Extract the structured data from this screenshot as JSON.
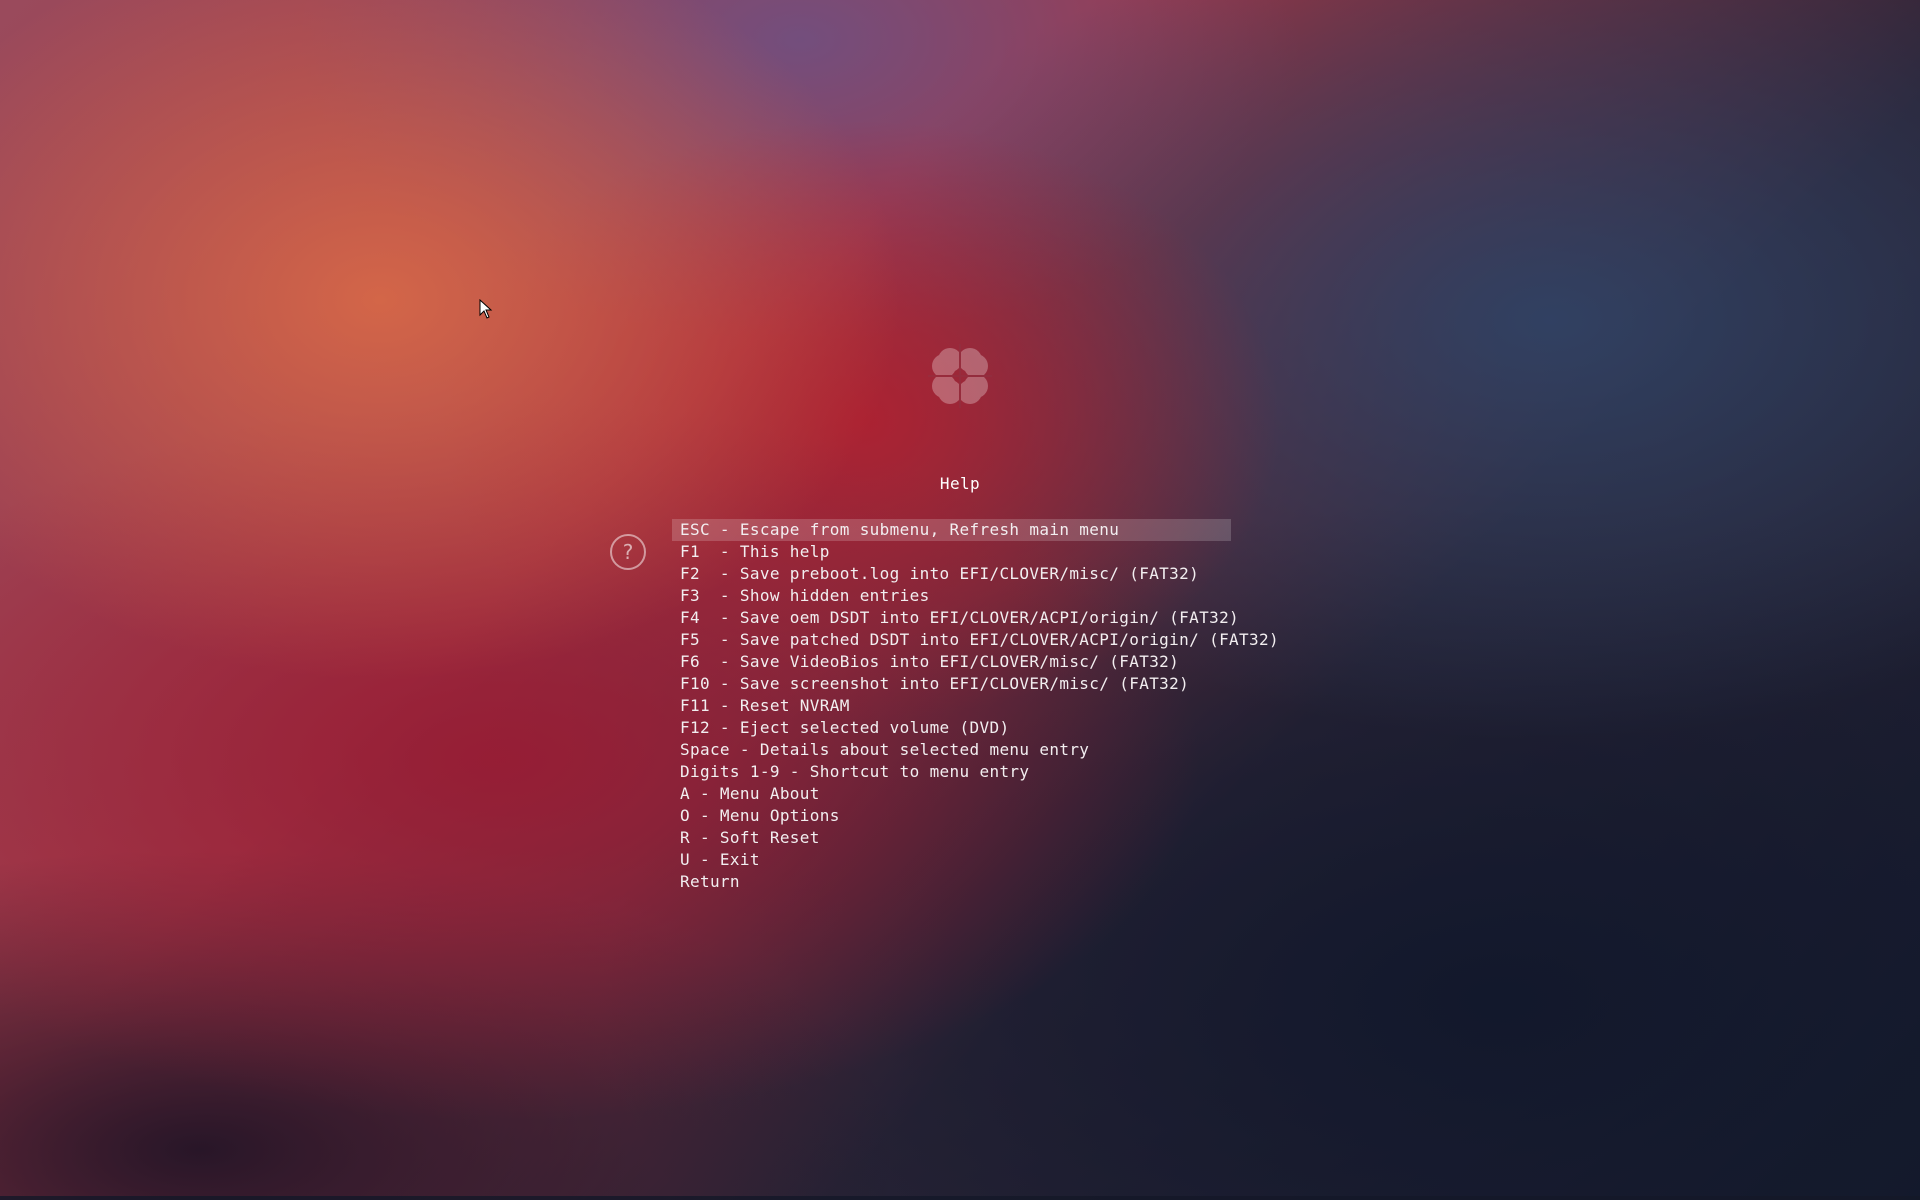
{
  "screen": {
    "title": "Help"
  },
  "help": {
    "items": [
      {
        "label": "ESC - Escape from submenu, Refresh main menu"
      },
      {
        "label": "F1  - This help"
      },
      {
        "label": "F2  - Save preboot.log into EFI/CLOVER/misc/ (FAT32)"
      },
      {
        "label": "F3  - Show hidden entries"
      },
      {
        "label": "F4  - Save oem DSDT into EFI/CLOVER/ACPI/origin/ (FAT32)"
      },
      {
        "label": "F5  - Save patched DSDT into EFI/CLOVER/ACPI/origin/ (FAT32)"
      },
      {
        "label": "F6  - Save VideoBios into EFI/CLOVER/misc/ (FAT32)"
      },
      {
        "label": "F10 - Save screenshot into EFI/CLOVER/misc/ (FAT32)"
      },
      {
        "label": "F11 - Reset NVRAM"
      },
      {
        "label": "F12 - Eject selected volume (DVD)"
      },
      {
        "label": "Space - Details about selected menu entry"
      },
      {
        "label": "Digits 1-9 - Shortcut to menu entry"
      },
      {
        "label": "A - Menu About"
      },
      {
        "label": "O - Menu Options"
      },
      {
        "label": "R - Soft Reset"
      },
      {
        "label": "U - Exit"
      },
      {
        "label": "Return"
      }
    ],
    "selected_index": 0
  },
  "icons": {
    "logo": "clover-logo-icon",
    "help": "question-mark-icon",
    "cursor": "mouse-pointer-icon",
    "help_glyph": "?"
  },
  "colors": {
    "text": "#f2eef0",
    "selection": "rgba(255,255,255,0.18)"
  }
}
